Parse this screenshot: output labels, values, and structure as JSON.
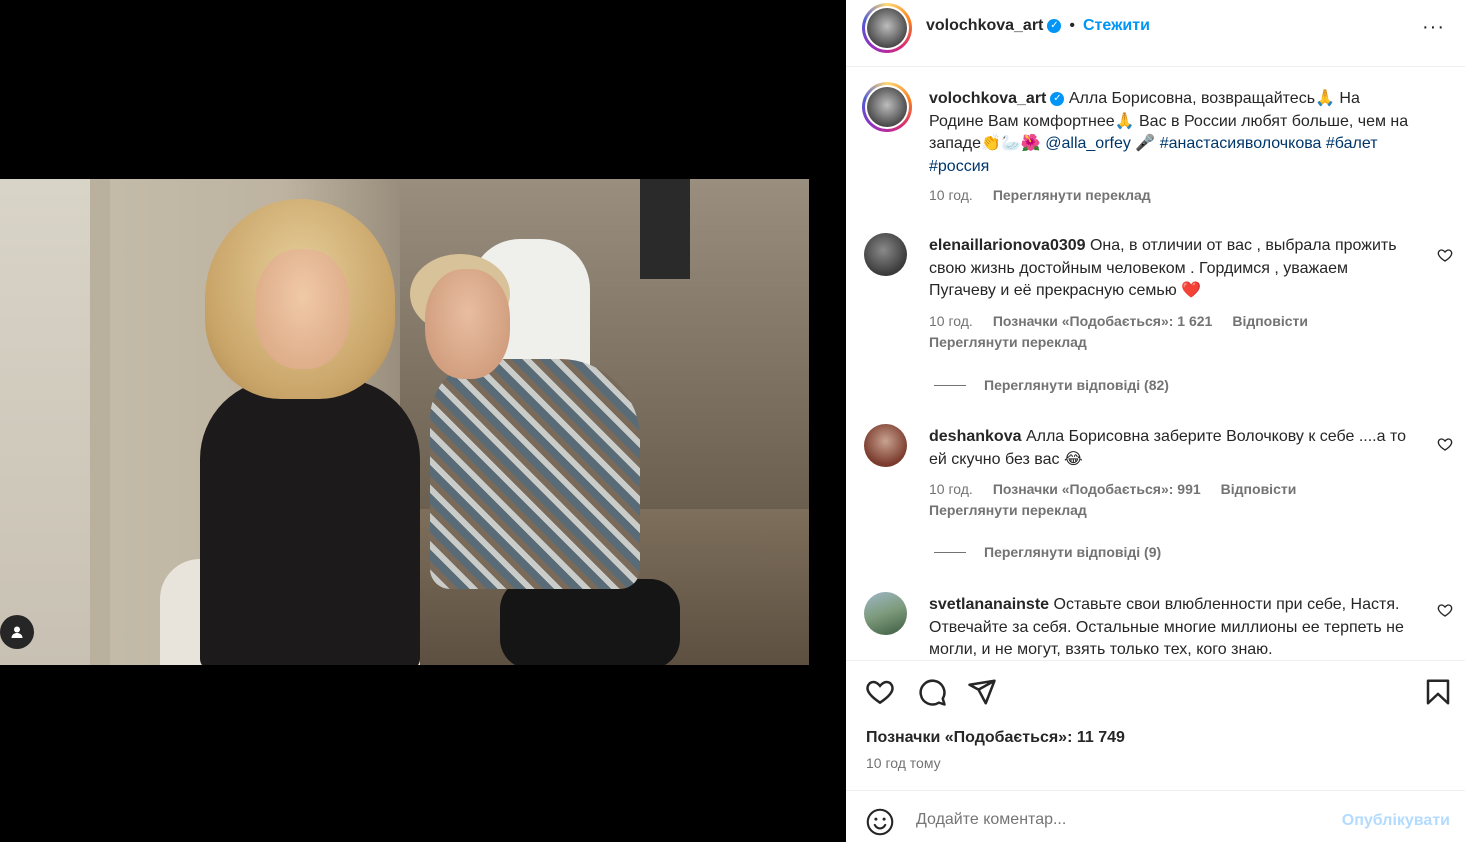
{
  "header": {
    "username": "volochkova_art",
    "follow_label": "Стежити",
    "separator": "•",
    "more": "···"
  },
  "caption": {
    "username": "volochkova_art",
    "text_part1": "Алла Борисовна, возвращайтесь🙏 На Родине Вам комфортнее🙏 Вас в России любят больше, чем на западе👏🦢🌺 ",
    "mention": "@alla_orfey",
    "text_part2": " 🎤 ",
    "hashtag1": "#анастасияволочкова",
    "hashtag2": "#балет",
    "hashtag3": "#россия",
    "time": "10 год.",
    "translate": "Переглянути переклад"
  },
  "comments": [
    {
      "username": "elenaillarionova0309",
      "text": "Она, в отличии от вас , выбрала прожить свою жизнь достойным человеком . Гордимся , уважаем Пугачеву и её прекрасную семью ❤️",
      "time": "10 год.",
      "likes": "Позначки «Подобається»: 1 621",
      "reply": "Відповісти",
      "translate": "Переглянути переклад",
      "replies": "Переглянути відповіді (82)"
    },
    {
      "username": "deshankova",
      "text": "Алла Борисовна заберите Волочкову к себе ....а то ей скучно без вас 😂",
      "time": "10 год.",
      "likes": "Позначки «Подобається»: 991",
      "reply": "Відповісти",
      "translate": "Переглянути переклад",
      "replies": "Переглянути відповіді (9)"
    },
    {
      "username": "svetlananainste",
      "text": "Оставьте свои влюбленности при себе, Настя. Отвечайте за себя. Остальные многие миллионы ее терпеть не могли, и не могут, взять только тех, кого знаю."
    }
  ],
  "footer": {
    "likes": "Позначки «Подобається»: 11 749",
    "ago": "10 год тому",
    "comment_placeholder": "Додайте коментар...",
    "post_label": "Опублікувати"
  },
  "colors": {
    "accent": "#0095f6",
    "muted": "#737373",
    "text": "#262626",
    "link": "#00376b"
  }
}
